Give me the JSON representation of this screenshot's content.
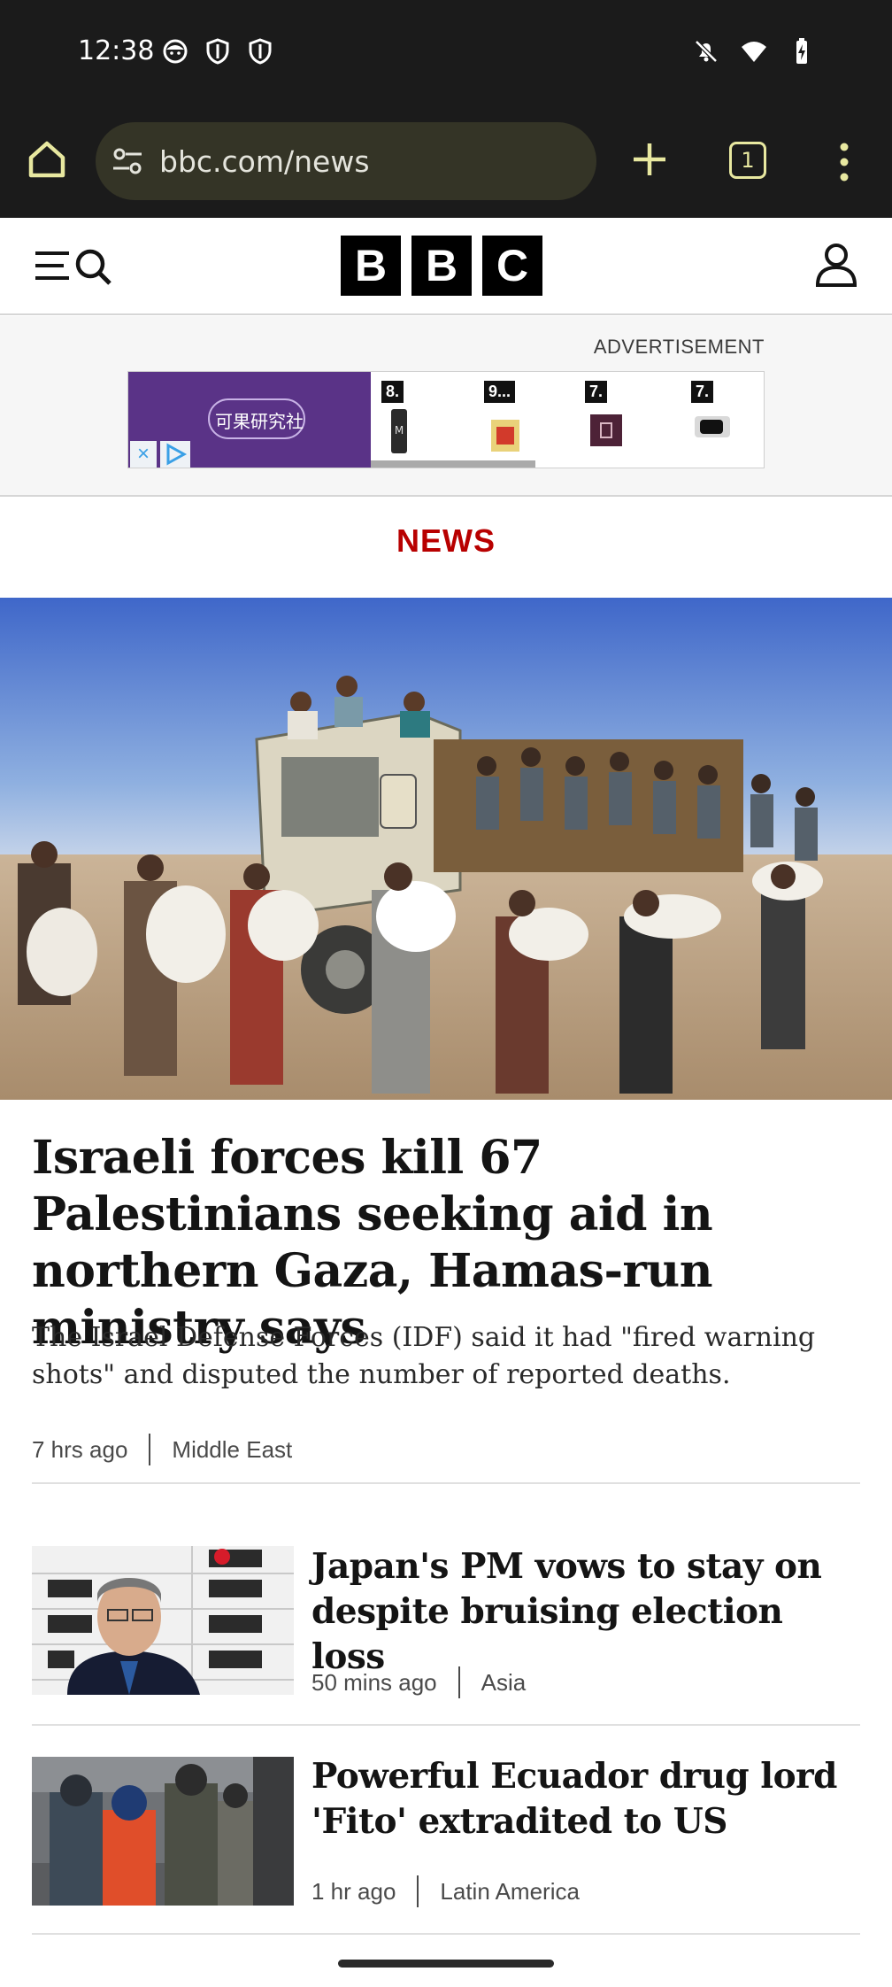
{
  "status_bar": {
    "time": "12:38",
    "left_icons": [
      "face-notification-icon",
      "shield-icon",
      "shield-icon"
    ],
    "right_icons": [
      "mute-icon",
      "wifi-icon",
      "battery-charging-icon"
    ]
  },
  "browser": {
    "url": "bbc.com/news",
    "tab_count": "1",
    "icons": [
      "home-icon",
      "tune-icon",
      "plus-icon",
      "more-vert-icon"
    ]
  },
  "site_header": {
    "logo_letters": [
      "B",
      "B",
      "C"
    ],
    "icons": [
      "menu-icon",
      "search-icon",
      "account-icon"
    ]
  },
  "advertisement": {
    "label": "ADVERTISEMENT",
    "brand_text": "可果研究社",
    "products": [
      {
        "rank": "8."
      },
      {
        "rank": "9..."
      },
      {
        "rank": "7."
      },
      {
        "rank": "7."
      }
    ]
  },
  "section": {
    "label": "NEWS"
  },
  "lead_story": {
    "title": "Israeli forces kill 67 Palestinians seeking aid in northern Gaza, Hamas-run ministry says",
    "summary": "The Israel Defense Forces (IDF) said it had \"fired warning shots\" and disputed the number of reported deaths.",
    "time": "7 hrs ago",
    "category": "Middle East"
  },
  "stories": [
    {
      "title": "Japan's PM vows to stay on despite bruising election loss",
      "time": "50 mins ago",
      "category": "Asia"
    },
    {
      "title": "Powerful Ecuador drug lord 'Fito' extradited to US",
      "time": "1 hr ago",
      "category": "Latin America"
    }
  ],
  "colors": {
    "bbc_red": "#b80000",
    "chrome_bar": "#1b1b1b",
    "url_pill": "#343426"
  }
}
